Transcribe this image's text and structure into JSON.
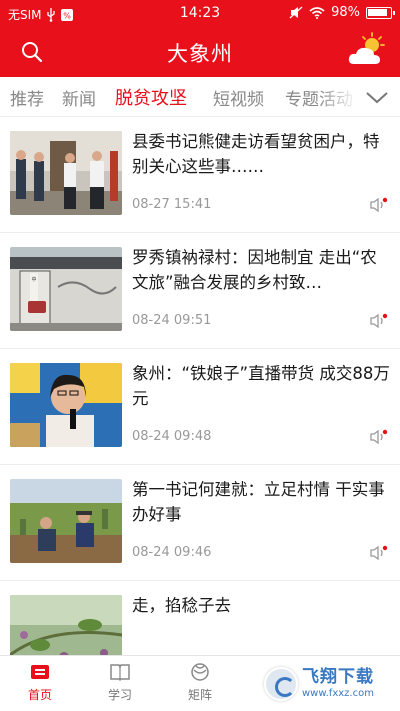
{
  "status_bar": {
    "carrier": "无SIM",
    "time": "14:23",
    "battery": "98%"
  },
  "app": {
    "title": "大象州"
  },
  "tabs": [
    {
      "label": "推荐"
    },
    {
      "label": "新闻"
    },
    {
      "label": "脱贫攻坚",
      "active": true
    },
    {
      "label": "短视频"
    },
    {
      "label": "专题活动"
    }
  ],
  "feed": [
    {
      "title": "县委书记熊健走访看望贫困户，特别关心这些事……",
      "time": "08-27 15:41"
    },
    {
      "title": "罗秀镇衲禄村：因地制宜 走出“农文旅”融合发展的乡村致…",
      "time": "08-24 09:51"
    },
    {
      "title": "象州：“铁娘子”直播带货 成交88万元",
      "time": "08-24 09:48"
    },
    {
      "title": "第一书记何建就：立足村情 干实事 办好事",
      "time": "08-24 09:46"
    },
    {
      "title": "走，掐稔子去",
      "time": ""
    }
  ],
  "bottom_nav": [
    {
      "label": "首页",
      "icon": "home-icon",
      "active": true
    },
    {
      "label": "学习",
      "icon": "book-icon"
    },
    {
      "label": "矩阵",
      "icon": "matrix-icon"
    }
  ],
  "watermark": {
    "brand": "飞翔下载",
    "url": "www.fxxz.com"
  },
  "colors": {
    "brand_red": "#e8101b",
    "tab_inactive": "#888888",
    "meta_gray": "#999999"
  }
}
